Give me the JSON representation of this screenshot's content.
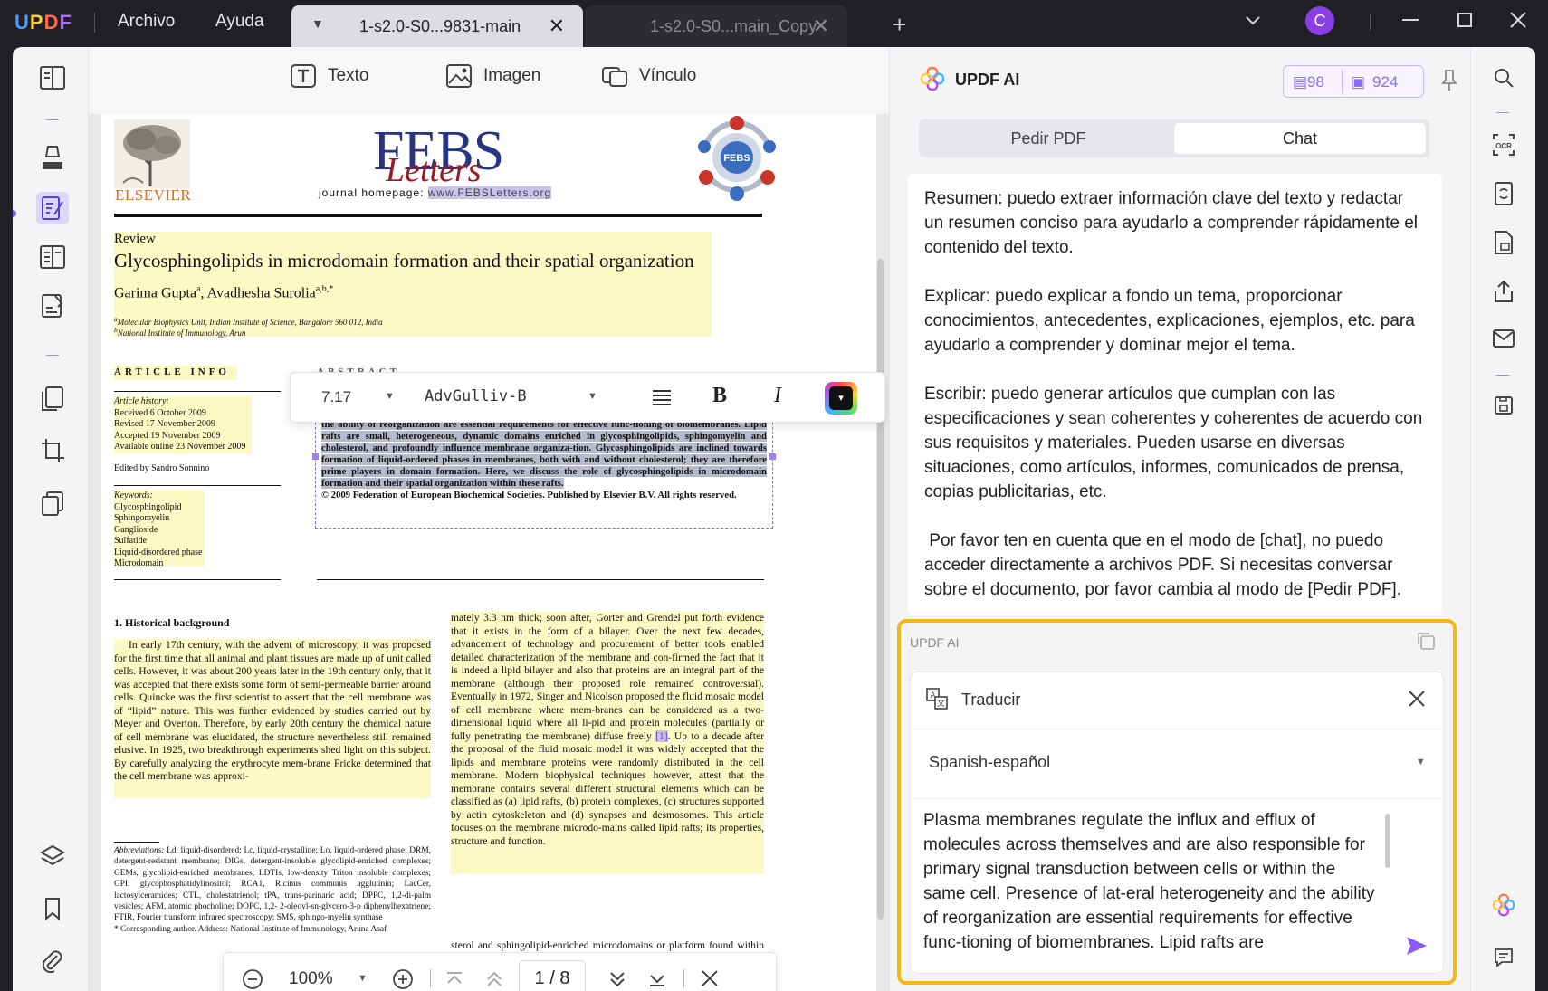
{
  "titlebar": {
    "logo": {
      "u": "U",
      "p": "P",
      "d": "D",
      "f": "F"
    },
    "menu": [
      "Archivo",
      "Ayuda"
    ],
    "tabs": [
      {
        "label": "1-s2.0-S0...9831-main",
        "active": true
      },
      {
        "label": "1-s2.0-S0...main_Copy",
        "active": false
      }
    ],
    "avatar_letter": "C"
  },
  "edit_toolbar": {
    "text": "Texto",
    "image": "Imagen",
    "link": "Vínculo"
  },
  "document": {
    "publisher": "ELSEVIER",
    "journal_big": "FEBS",
    "journal_script": "Letters",
    "homepage_label": "journal homepage:",
    "homepage_url": "www.FEBSLetters.org",
    "badge": "FEBS",
    "section_label": "Review",
    "title": "Glycosphingolipids in microdomain formation and their spatial organization",
    "authors": "Garima Gupta",
    "author1_sup": "a",
    "authors_sep": ", Avadhesha Surolia",
    "author2_sup": "a,b,*",
    "affil_a": "Molecular Biophysics Unit, Indian Institute of Science, Bangalore 560 012, India",
    "affil_a_sup": "a",
    "affil_b": "National Institute of Immunology, Arun",
    "affil_b_sup": "b",
    "article_info": "ARTICLE INFO",
    "abstract_heading_partial": "ABSTRACT",
    "history_label": "Article history:",
    "history": [
      "Received 6 October 2009",
      "Revised 17 November 2009",
      "Accepted 19 November 2009",
      "Available online 23 November 2009"
    ],
    "edited_by": "Edited by Sandro Sonnino",
    "keywords_label": "Keywords:",
    "keywords": [
      "Glycosphingolipid",
      "Sphingomyelin",
      "Ganglioside",
      "Sulfatide",
      "Liquid-disordered phase",
      "Microdomain"
    ],
    "abstract": "Plasma membranes regulate the influx and efflux of molecules across themselves and are also responsible for primary signal transduction between cells or within the same cell. Presence of lat-eral heterogeneity and the ability of reorganization are essential requirements for effective func-tioning of biomembranes. Lipid rafts are small, heterogeneous, dynamic domains enriched in glycosphingolipids, sphingomyelin and cholesterol, and profoundly influence membrane organiza-tion. Glycosphingolipids are inclined towards formation of liquid-ordered phases in membranes, both with and without cholesterol; they are therefore prime players in domain formation. Here, we discuss the role of glycosphingolipids in microdomain formation and their spatial organization within these rafts.",
    "copyright": "© 2009 Federation of European Biochemical Societies. Published by Elsevier B.V. All rights reserved.",
    "section1_heading": "1. Historical background",
    "col1_text": "In early 17th century, with the advent of microscopy, it was proposed for the first time that all animal and plant tissues are made up of unit called cells. However, it was about 200 years later in the 19th century only, that it was accepted that there exists some form of semi-permeable barrier around cells. Quincke was the first scientist to assert that the cell membrane was of “lipid” nature. This was further evidenced by studies carried out by Meyer and Overton. Therefore, by early 20th century the chemical nature of cell membrane was elucidated, the structure nevertheless still remained elusive. In 1925, two breakthrough experiments shed light on this subject. By carefully analyzing the erythrocyte mem-brane Fricke determined that the cell membrane was approxi-",
    "col2_before_ref": "mately 3.3 nm thick; soon after, Gorter and Grendel put forth evidence that it exists in the form of a bilayer. Over the next few decades, advancement of technology and procurement of better tools enabled detailed characterization of the membrane and con-firmed the fact that it is indeed a lipid bilayer and also that proteins are an integral part of the membrane (although their proposed role remained controversial). Eventually in 1972, Singer and Nicolson proposed the fluid mosaic model of cell membrane where mem-branes can be considered as a two-dimensional liquid where all li-pid and protein molecules (partially or fully penetrating the membrane) diffuse freely ",
    "col2_ref": "[1]",
    "col2_after_ref": ". Up to a decade after the proposal of the fluid mosaic model it was widely accepted that the lipids and membrane proteins were randomly distributed in the cell membrane. Modern biophysical techniques however, attest that the membrane contains several different structural elements which can be classified as (a) lipid rafts, (b) protein complexes, (c) structures supported by actin cytoskeleton and (d) synapses and desmosomes. This article focuses on the membrane microdo-mains called lipid rafts; its properties, structure and function.",
    "col2_bottom": "sterol and sphingolipid-enriched microdomains or platform found within cell membranes. These specialized membrane microdomains are known to compartmentalize cellular processes by serving",
    "abbrev_label": "Abbreviations:",
    "abbrev_text": "Ld, liquid-disordered; Lc, liquid-crystalline; Lo, liquid-ordered phase; DRM, detergent-resistant membrane; DIGs, detergent-insoluble glycolipid-enriched complexes; GEMs, glycolipid-enriched membranes; LDTIs, low-density Triton insoluble complexes; GPI, glycophosphatidylinositol; RCA1, Ricinus communis agglutinin; LacCer, lactosylceramides; CTL, cholestatrienol; tPA, trans-parinaric acid; DPPC, 1,2-di-palm vesicles; AFM, atomic phocholine; DOPC, 1,2- 2-oleoyl-sn-glycero-3-p diphenylhexatriene; FTIR, Fourier transform infrared spectroscopy; SMS, sphingo-myelin synthase",
    "corresponding": "* Corresponding author. Address: National Institute of Immunology, Aruna Asaf"
  },
  "format_bar": {
    "font_size": "7.17",
    "font_name": "AdvGulliv-B",
    "bold": "B",
    "italic": "I",
    "text_color": "#111111"
  },
  "page_nav": {
    "zoom": "100%",
    "current_page": "1",
    "sep": "/",
    "total_pages": "8"
  },
  "ai_panel": {
    "title": "UPDF AI",
    "counter_pdf": "98",
    "counter_chat": "924",
    "tabs": [
      "Pedir PDF",
      "Chat"
    ],
    "active_tab": "Chat",
    "messages": [
      "Resumen: puedo extraer información clave del texto y redactar un resumen conciso para ayudarlo a comprender rápidamente el contenido del texto.",
      "Explicar: puedo explicar a fondo un tema, proporcionar conocimientos, antecedentes, explicaciones, ejemplos, etc. para ayudarlo a comprender y dominar mejor el tema.",
      "Escribir: puedo generar artículos que cumplan con las especificaciones y sean coherentes y coherentes de acuerdo con sus requisitos y materiales. Pueden usarse en diversas situaciones, como artículos, informes, comunicados de prensa, copias publicitarias, etc.",
      " Por favor ten en cuenta que en el modo de [chat], no puedo acceder directamente a archivos PDF. Si necesitas conversar sobre el documento, por favor cambia al modo de [Pedir PDF]."
    ],
    "reply_label": "UPDF AI",
    "translate_label": "Traducir",
    "language": "Spanish-español",
    "input_text": "Plasma membranes regulate the influx and efflux of molecules across themselves and are also responsible for primary signal transduction between cells or within the same cell. Presence of lat-eral heterogeneity and the ability of reorganization are essential requirements for effective func-tioning of biomembranes. Lipid rafts are"
  },
  "colors": {
    "accent": "#7b5cf5",
    "highlight": "#fdf9c4",
    "selection": "#b7b9cc",
    "frame": "#f5b913"
  }
}
